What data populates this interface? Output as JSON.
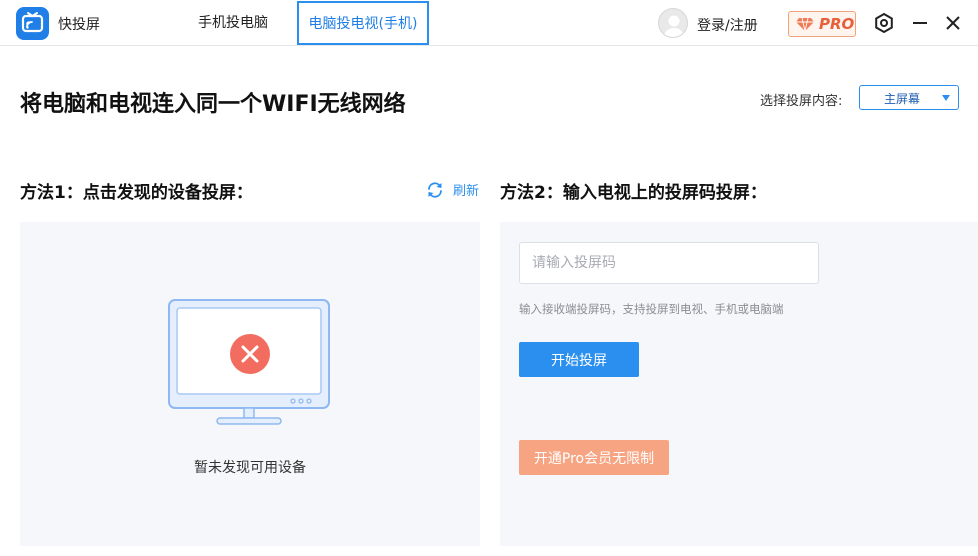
{
  "app": {
    "name": "快投屏",
    "logo_icon": "tv-cast-icon",
    "accent_color": "#2b8ff0"
  },
  "tabs": [
    {
      "label": "手机投电脑",
      "active": false
    },
    {
      "label": "电脑投电视(手机)",
      "active": true
    }
  ],
  "header": {
    "login_label": "登录/注册",
    "pro_badge": "PRO"
  },
  "main": {
    "headline": "将电脑和电视连入同一个WIFI无线网络",
    "select_label": "选择投屏内容:",
    "select_value": "主屏幕"
  },
  "method1": {
    "title": "方法1：点击发现的设备投屏：",
    "refresh_label": "刷新",
    "empty_text": "暂未发现可用设备"
  },
  "method2": {
    "title": "方法2：输入电视上的投屏码投屏：",
    "input_value": "",
    "input_placeholder": "请输入投屏码",
    "hint": "输入接收端投屏码，支持投屏到电视、手机或电脑端",
    "start_button": "开始投屏",
    "pro_button": "开通Pro会员无限制"
  }
}
